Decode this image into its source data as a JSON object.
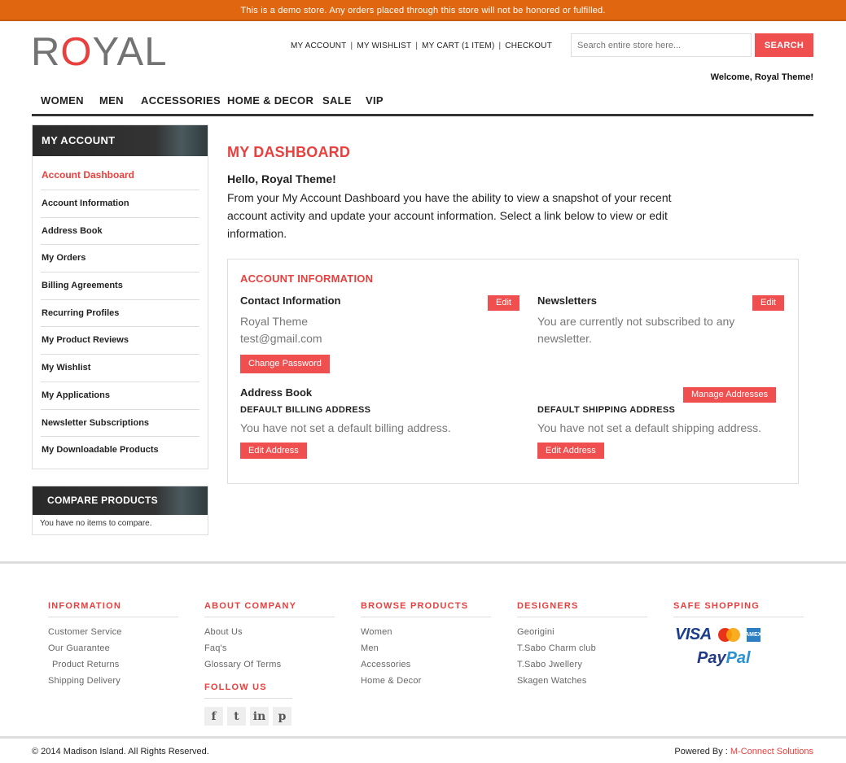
{
  "demo_notice": "This is a demo store. Any orders placed through this store will not be honored or fulfilled.",
  "logo": {
    "pre": "R",
    "o": "O",
    "post": "YAL"
  },
  "header": {
    "links": [
      "MY ACCOUNT",
      "MY WISHLIST",
      "MY CART (1 ITEM)",
      "CHECKOUT"
    ],
    "separator": "|",
    "search_placeholder": "Search entire store here...",
    "search_button": "SEARCH",
    "welcome": "Welcome, Royal Theme!"
  },
  "nav": [
    "WOMEN",
    "MEN",
    "ACCESSORIES",
    "HOME & DECOR",
    "SALE",
    "VIP"
  ],
  "sidebar": {
    "title": "MY ACCOUNT",
    "items": [
      "Account Dashboard",
      "Account Information",
      "Address Book",
      "My Orders",
      "Billing Agreements",
      "Recurring Profiles",
      "My Product Reviews",
      "My Wishlist",
      "My Applications",
      "Newsletter Subscriptions",
      "My Downloadable Products"
    ]
  },
  "compare": {
    "title": "COMPARE PRODUCTS",
    "text": "You have no items to compare."
  },
  "dashboard": {
    "title": "MY DASHBOARD",
    "hello": "Hello, Royal Theme!",
    "intro": "From your My Account Dashboard you have the ability to view a snapshot of your recent account activity and update your account information. Select a link below to view or edit information."
  },
  "account_info": {
    "title": "ACCOUNT INFORMATION",
    "contact_title": "Contact Information",
    "contact_edit": "Edit",
    "name": "Royal Theme",
    "email": "test@gmail.com",
    "change_password": "Change Password",
    "newsletters_title": "Newsletters",
    "newsletters_edit": "Edit",
    "newsletters_text": "You are currently not subscribed to any newsletter.",
    "address_book_title": "Address Book",
    "manage_addresses": "Manage Addresses",
    "billing_caption": "DEFAULT BILLING ADDRESS",
    "billing_text": "You have not set a default billing address.",
    "billing_edit": "Edit Address",
    "shipping_caption": "DEFAULT SHIPPING ADDRESS",
    "shipping_text": "You have not set a default shipping address.",
    "shipping_edit": "Edit Address"
  },
  "footer": {
    "information": {
      "title": "INFORMATION",
      "items": [
        "Customer Service",
        "Our Guarantee",
        " Product Returns",
        "Shipping Delivery"
      ]
    },
    "about": {
      "title": "ABOUT COMPANY",
      "items": [
        "About Us",
        "Faq's",
        "Glossary Of Terms"
      ]
    },
    "follow_title": "FOLLOW US",
    "social_icons": [
      "facebook-icon",
      "twitter-icon",
      "linkedin-icon",
      "pinterest-icon"
    ],
    "social_glyphs": [
      "f",
      "t",
      "in",
      "p"
    ],
    "browse": {
      "title": "BROWSE PRODUCTS",
      "items": [
        "Women",
        "Men",
        "Accessories",
        "Home & Decor"
      ]
    },
    "designers": {
      "title": "DESIGNERS",
      "items": [
        "Georigini",
        "T.Sabo Charm club",
        "T.Sabo Jwellery",
        "Skagen Watches"
      ]
    },
    "safe": {
      "title": "SAFE SHOPPING",
      "visa": "VISA",
      "amex": "AMEX",
      "paypal_pay": "Pay",
      "paypal_pal": "Pal"
    },
    "copyright": "© 2014 Madison Island. All Rights Reserved.",
    "powered_prefix": "Powered By : ",
    "powered_link": "M-Connect Solutions"
  },
  "colors": {
    "accent": "#e8403e",
    "demo_bar": "#e0660f",
    "button": "#f04f4f"
  }
}
